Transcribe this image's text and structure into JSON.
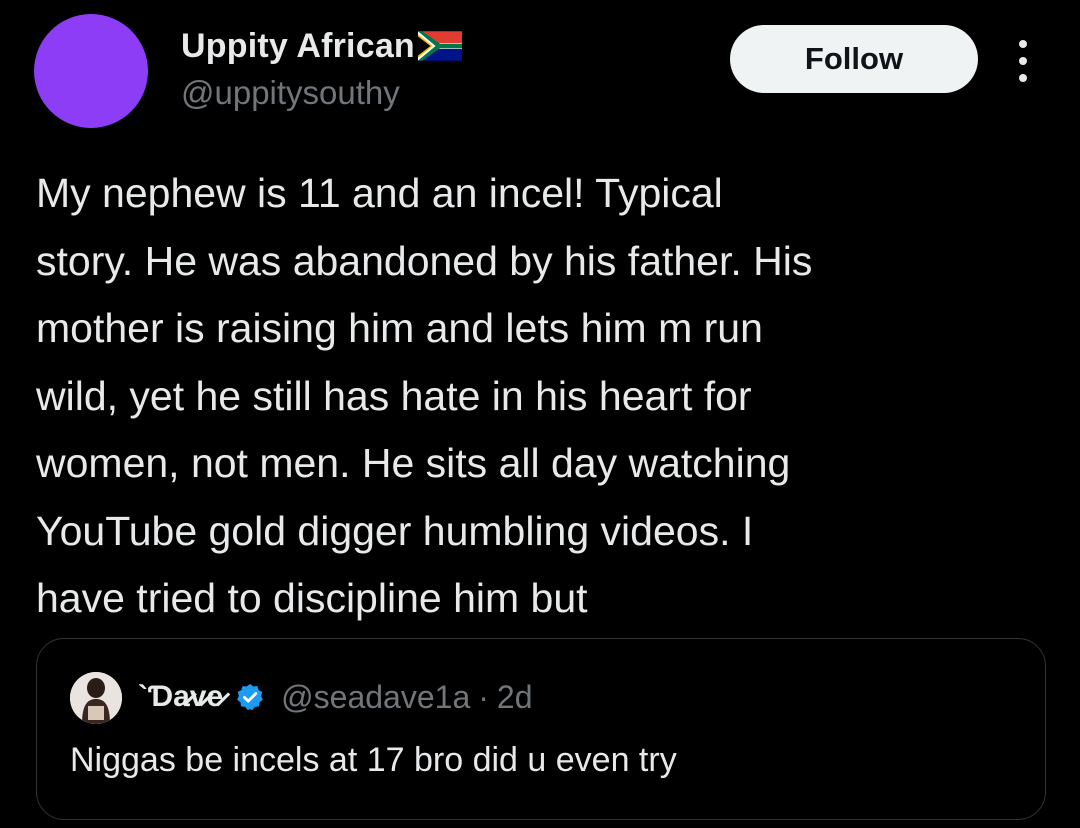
{
  "author": {
    "display_name": "Uppity African",
    "handle": "@uppitysouthy",
    "flag_icon": "south-africa-flag-icon",
    "avatar_color": "#8c3df5"
  },
  "actions": {
    "follow_label": "Follow",
    "more_icon": "more-vertical-icon"
  },
  "tweet": {
    "text": "My nephew is 11 and an incel! Typical\nstory. He was abandoned by his father. His\nmother is raising him and lets him m run\nwild, yet he still has hate in his heart for\nwomen, not men. He sits all day watching\nYouTube gold digger humbling videos. I\nhave tried to discipline him but"
  },
  "quoted_tweet": {
    "display_name": "`Ɗa̷v̷e̷",
    "verified_icon": "verified-badge-icon",
    "handle": "@seadave1a",
    "separator": "·",
    "time": "2d",
    "text": "Niggas be incels at 17 bro did u even try"
  },
  "colors": {
    "background": "#000000",
    "text_primary": "#e7e9ea",
    "text_secondary": "#71767b",
    "border": "#2f3336",
    "verified_blue": "#1d9bf0",
    "follow_bg": "#eff3f4"
  }
}
